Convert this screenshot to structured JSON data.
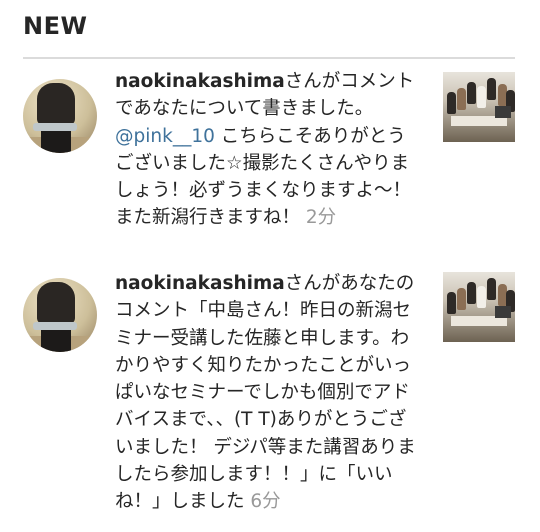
{
  "header": {
    "title": "NEW"
  },
  "notifications": [
    {
      "username": "naokinakashima",
      "action": "さんがコメントであなたについて書きました。",
      "mention": "@pink__10",
      "message": " こちらこそありがとうございました☆撮影たくさんやりましょう！必ずうまくなりますよ～！また新潟行きますね！",
      "time": " 2分"
    },
    {
      "username": "naokinakashima",
      "action": "さんがあなたのコメント「中島さん！昨日の新潟セミナー受講した佐藤と申します。わかりやすく知りたかったことがいっぱいなセミナーでしかも個別でアドバイスまで、、(T T)ありがとうございました！ デジパ等また講習ありましたら参加します！！」に「いいね！」しました",
      "time": " 6分"
    }
  ]
}
